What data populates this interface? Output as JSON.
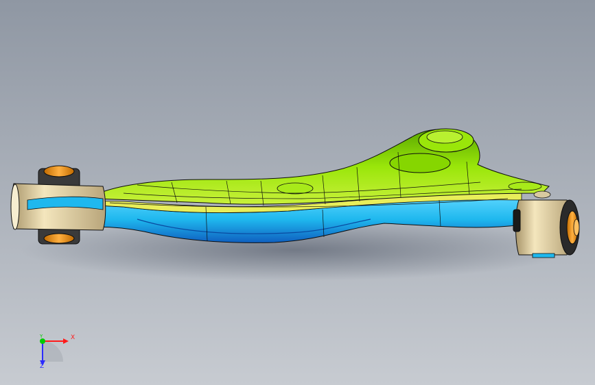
{
  "viewport": {
    "background_top": "#8f97a3",
    "background_bottom": "#c7cbd1"
  },
  "model": {
    "colors": {
      "arm_green": "#8ee000",
      "arm_green_dark": "#4f9a00",
      "arm_yellow": "#e8ee5a",
      "arm_blue": "#1fb8ee",
      "arm_blue_dark": "#1272c8",
      "bushing_tan": "#e8d7a8",
      "bushing_orange": "#f59a16",
      "edge_black": "#0d0d0d"
    }
  },
  "triad": {
    "x_label": "X",
    "y_label": "Y",
    "z_label": "Z",
    "x_color": "#ff1a1a",
    "y_color": "#00cc00",
    "z_color": "#2b2bff"
  }
}
